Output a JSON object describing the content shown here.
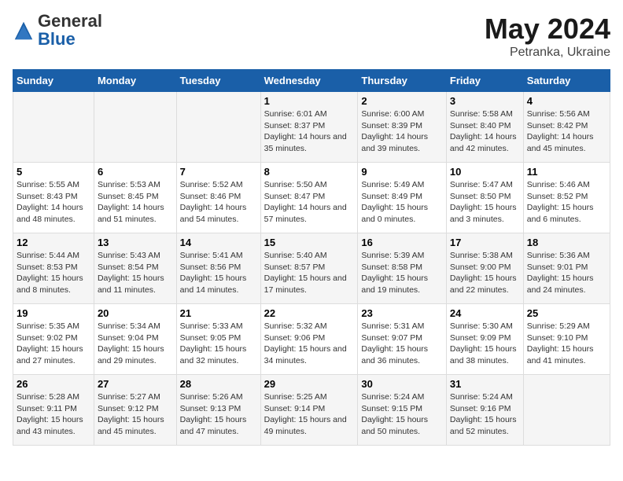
{
  "logo": {
    "general": "General",
    "blue": "Blue"
  },
  "title": "May 2024",
  "subtitle": "Petranka, Ukraine",
  "days": [
    "Sunday",
    "Monday",
    "Tuesday",
    "Wednesday",
    "Thursday",
    "Friday",
    "Saturday"
  ],
  "weeks": [
    [
      {
        "day": "",
        "info": ""
      },
      {
        "day": "",
        "info": ""
      },
      {
        "day": "",
        "info": ""
      },
      {
        "day": "1",
        "info": "Sunrise: 6:01 AM\nSunset: 8:37 PM\nDaylight: 14 hours\nand 35 minutes."
      },
      {
        "day": "2",
        "info": "Sunrise: 6:00 AM\nSunset: 8:39 PM\nDaylight: 14 hours\nand 39 minutes."
      },
      {
        "day": "3",
        "info": "Sunrise: 5:58 AM\nSunset: 8:40 PM\nDaylight: 14 hours\nand 42 minutes."
      },
      {
        "day": "4",
        "info": "Sunrise: 5:56 AM\nSunset: 8:42 PM\nDaylight: 14 hours\nand 45 minutes."
      }
    ],
    [
      {
        "day": "5",
        "info": "Sunrise: 5:55 AM\nSunset: 8:43 PM\nDaylight: 14 hours\nand 48 minutes."
      },
      {
        "day": "6",
        "info": "Sunrise: 5:53 AM\nSunset: 8:45 PM\nDaylight: 14 hours\nand 51 minutes."
      },
      {
        "day": "7",
        "info": "Sunrise: 5:52 AM\nSunset: 8:46 PM\nDaylight: 14 hours\nand 54 minutes."
      },
      {
        "day": "8",
        "info": "Sunrise: 5:50 AM\nSunset: 8:47 PM\nDaylight: 14 hours\nand 57 minutes."
      },
      {
        "day": "9",
        "info": "Sunrise: 5:49 AM\nSunset: 8:49 PM\nDaylight: 15 hours\nand 0 minutes."
      },
      {
        "day": "10",
        "info": "Sunrise: 5:47 AM\nSunset: 8:50 PM\nDaylight: 15 hours\nand 3 minutes."
      },
      {
        "day": "11",
        "info": "Sunrise: 5:46 AM\nSunset: 8:52 PM\nDaylight: 15 hours\nand 6 minutes."
      }
    ],
    [
      {
        "day": "12",
        "info": "Sunrise: 5:44 AM\nSunset: 8:53 PM\nDaylight: 15 hours\nand 8 minutes."
      },
      {
        "day": "13",
        "info": "Sunrise: 5:43 AM\nSunset: 8:54 PM\nDaylight: 15 hours\nand 11 minutes."
      },
      {
        "day": "14",
        "info": "Sunrise: 5:41 AM\nSunset: 8:56 PM\nDaylight: 15 hours\nand 14 minutes."
      },
      {
        "day": "15",
        "info": "Sunrise: 5:40 AM\nSunset: 8:57 PM\nDaylight: 15 hours\nand 17 minutes."
      },
      {
        "day": "16",
        "info": "Sunrise: 5:39 AM\nSunset: 8:58 PM\nDaylight: 15 hours\nand 19 minutes."
      },
      {
        "day": "17",
        "info": "Sunrise: 5:38 AM\nSunset: 9:00 PM\nDaylight: 15 hours\nand 22 minutes."
      },
      {
        "day": "18",
        "info": "Sunrise: 5:36 AM\nSunset: 9:01 PM\nDaylight: 15 hours\nand 24 minutes."
      }
    ],
    [
      {
        "day": "19",
        "info": "Sunrise: 5:35 AM\nSunset: 9:02 PM\nDaylight: 15 hours\nand 27 minutes."
      },
      {
        "day": "20",
        "info": "Sunrise: 5:34 AM\nSunset: 9:04 PM\nDaylight: 15 hours\nand 29 minutes."
      },
      {
        "day": "21",
        "info": "Sunrise: 5:33 AM\nSunset: 9:05 PM\nDaylight: 15 hours\nand 32 minutes."
      },
      {
        "day": "22",
        "info": "Sunrise: 5:32 AM\nSunset: 9:06 PM\nDaylight: 15 hours\nand 34 minutes."
      },
      {
        "day": "23",
        "info": "Sunrise: 5:31 AM\nSunset: 9:07 PM\nDaylight: 15 hours\nand 36 minutes."
      },
      {
        "day": "24",
        "info": "Sunrise: 5:30 AM\nSunset: 9:09 PM\nDaylight: 15 hours\nand 38 minutes."
      },
      {
        "day": "25",
        "info": "Sunrise: 5:29 AM\nSunset: 9:10 PM\nDaylight: 15 hours\nand 41 minutes."
      }
    ],
    [
      {
        "day": "26",
        "info": "Sunrise: 5:28 AM\nSunset: 9:11 PM\nDaylight: 15 hours\nand 43 minutes."
      },
      {
        "day": "27",
        "info": "Sunrise: 5:27 AM\nSunset: 9:12 PM\nDaylight: 15 hours\nand 45 minutes."
      },
      {
        "day": "28",
        "info": "Sunrise: 5:26 AM\nSunset: 9:13 PM\nDaylight: 15 hours\nand 47 minutes."
      },
      {
        "day": "29",
        "info": "Sunrise: 5:25 AM\nSunset: 9:14 PM\nDaylight: 15 hours\nand 49 minutes."
      },
      {
        "day": "30",
        "info": "Sunrise: 5:24 AM\nSunset: 9:15 PM\nDaylight: 15 hours\nand 50 minutes."
      },
      {
        "day": "31",
        "info": "Sunrise: 5:24 AM\nSunset: 9:16 PM\nDaylight: 15 hours\nand 52 minutes."
      },
      {
        "day": "",
        "info": ""
      }
    ]
  ]
}
